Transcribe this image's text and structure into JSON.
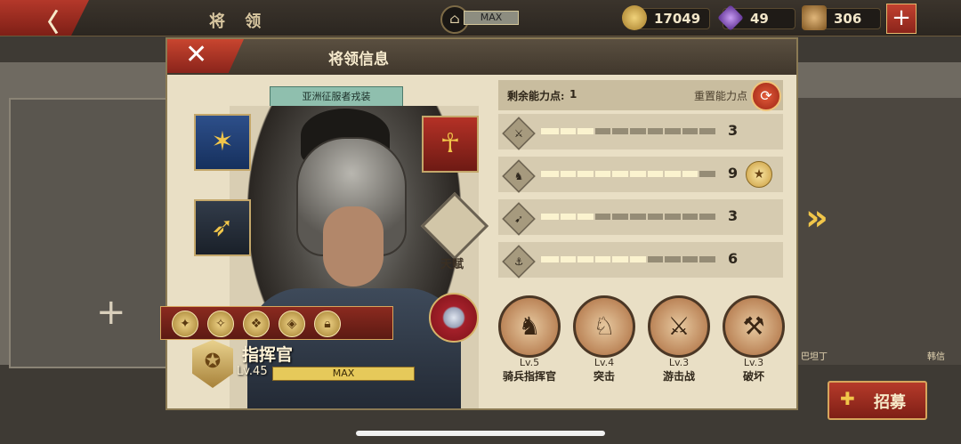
{
  "topbar": {
    "back_icon": "back-arrow-icon",
    "title": "将 领",
    "level_status": "MAX",
    "resources": [
      {
        "name": "gold",
        "icon": "gold-coin-icon",
        "value": "17049",
        "color": "#c9a34a"
      },
      {
        "name": "gems",
        "icon": "purple-gem-icon",
        "value": "49",
        "color": "#8b58c9"
      },
      {
        "name": "food",
        "icon": "food-basket-icon",
        "value": "306",
        "color": "#b98a3e"
      }
    ],
    "add_label": "+"
  },
  "panel": {
    "title": "将领信息",
    "close_label": "✕",
    "outfit_tag": "亚洲征服者戎装",
    "talent_label": "天赋",
    "hero": {
      "rank": "指挥官",
      "level": "Lv.45",
      "level_status": "MAX",
      "level_progress": 1.0
    },
    "equipment": [
      {
        "name": "banner",
        "icon": "legion-banner-icon"
      },
      {
        "name": "spear",
        "icon": "spear-icon"
      },
      {
        "name": "mask",
        "icon": "pharaoh-mask-icon"
      }
    ],
    "skill_icons": [
      "skill-1-icon",
      "skill-2-icon",
      "skill-3-icon",
      "skill-4-icon",
      "lock-icon"
    ],
    "points": {
      "remaining_label": "剩余能力点:",
      "remaining_value": "1",
      "reset_label": "重置能力点"
    },
    "stats": [
      {
        "icon": "sword-icon",
        "value": "3",
        "max": 10,
        "starred": false
      },
      {
        "icon": "horse-icon",
        "value": "9",
        "max": 10,
        "starred": true
      },
      {
        "icon": "bow-icon",
        "value": "3",
        "max": 10,
        "starred": false
      },
      {
        "icon": "anchor-icon",
        "value": "6",
        "max": 10,
        "starred": false
      }
    ],
    "tactics": [
      {
        "icon": "cavalry-head-icon",
        "level": "Lv.5",
        "name": "骑兵指挥官"
      },
      {
        "icon": "charge-rider-icon",
        "level": "Lv.4",
        "name": "突击"
      },
      {
        "icon": "skirmish-icon",
        "level": "Lv.3",
        "name": "游击战"
      },
      {
        "icon": "siege-ram-icon",
        "level": "Lv.3",
        "name": "破坏"
      }
    ]
  },
  "side": {
    "next_arrow": "»",
    "recruit_label": "招募",
    "right_names": [
      "巴坦丁",
      "韩信"
    ]
  }
}
